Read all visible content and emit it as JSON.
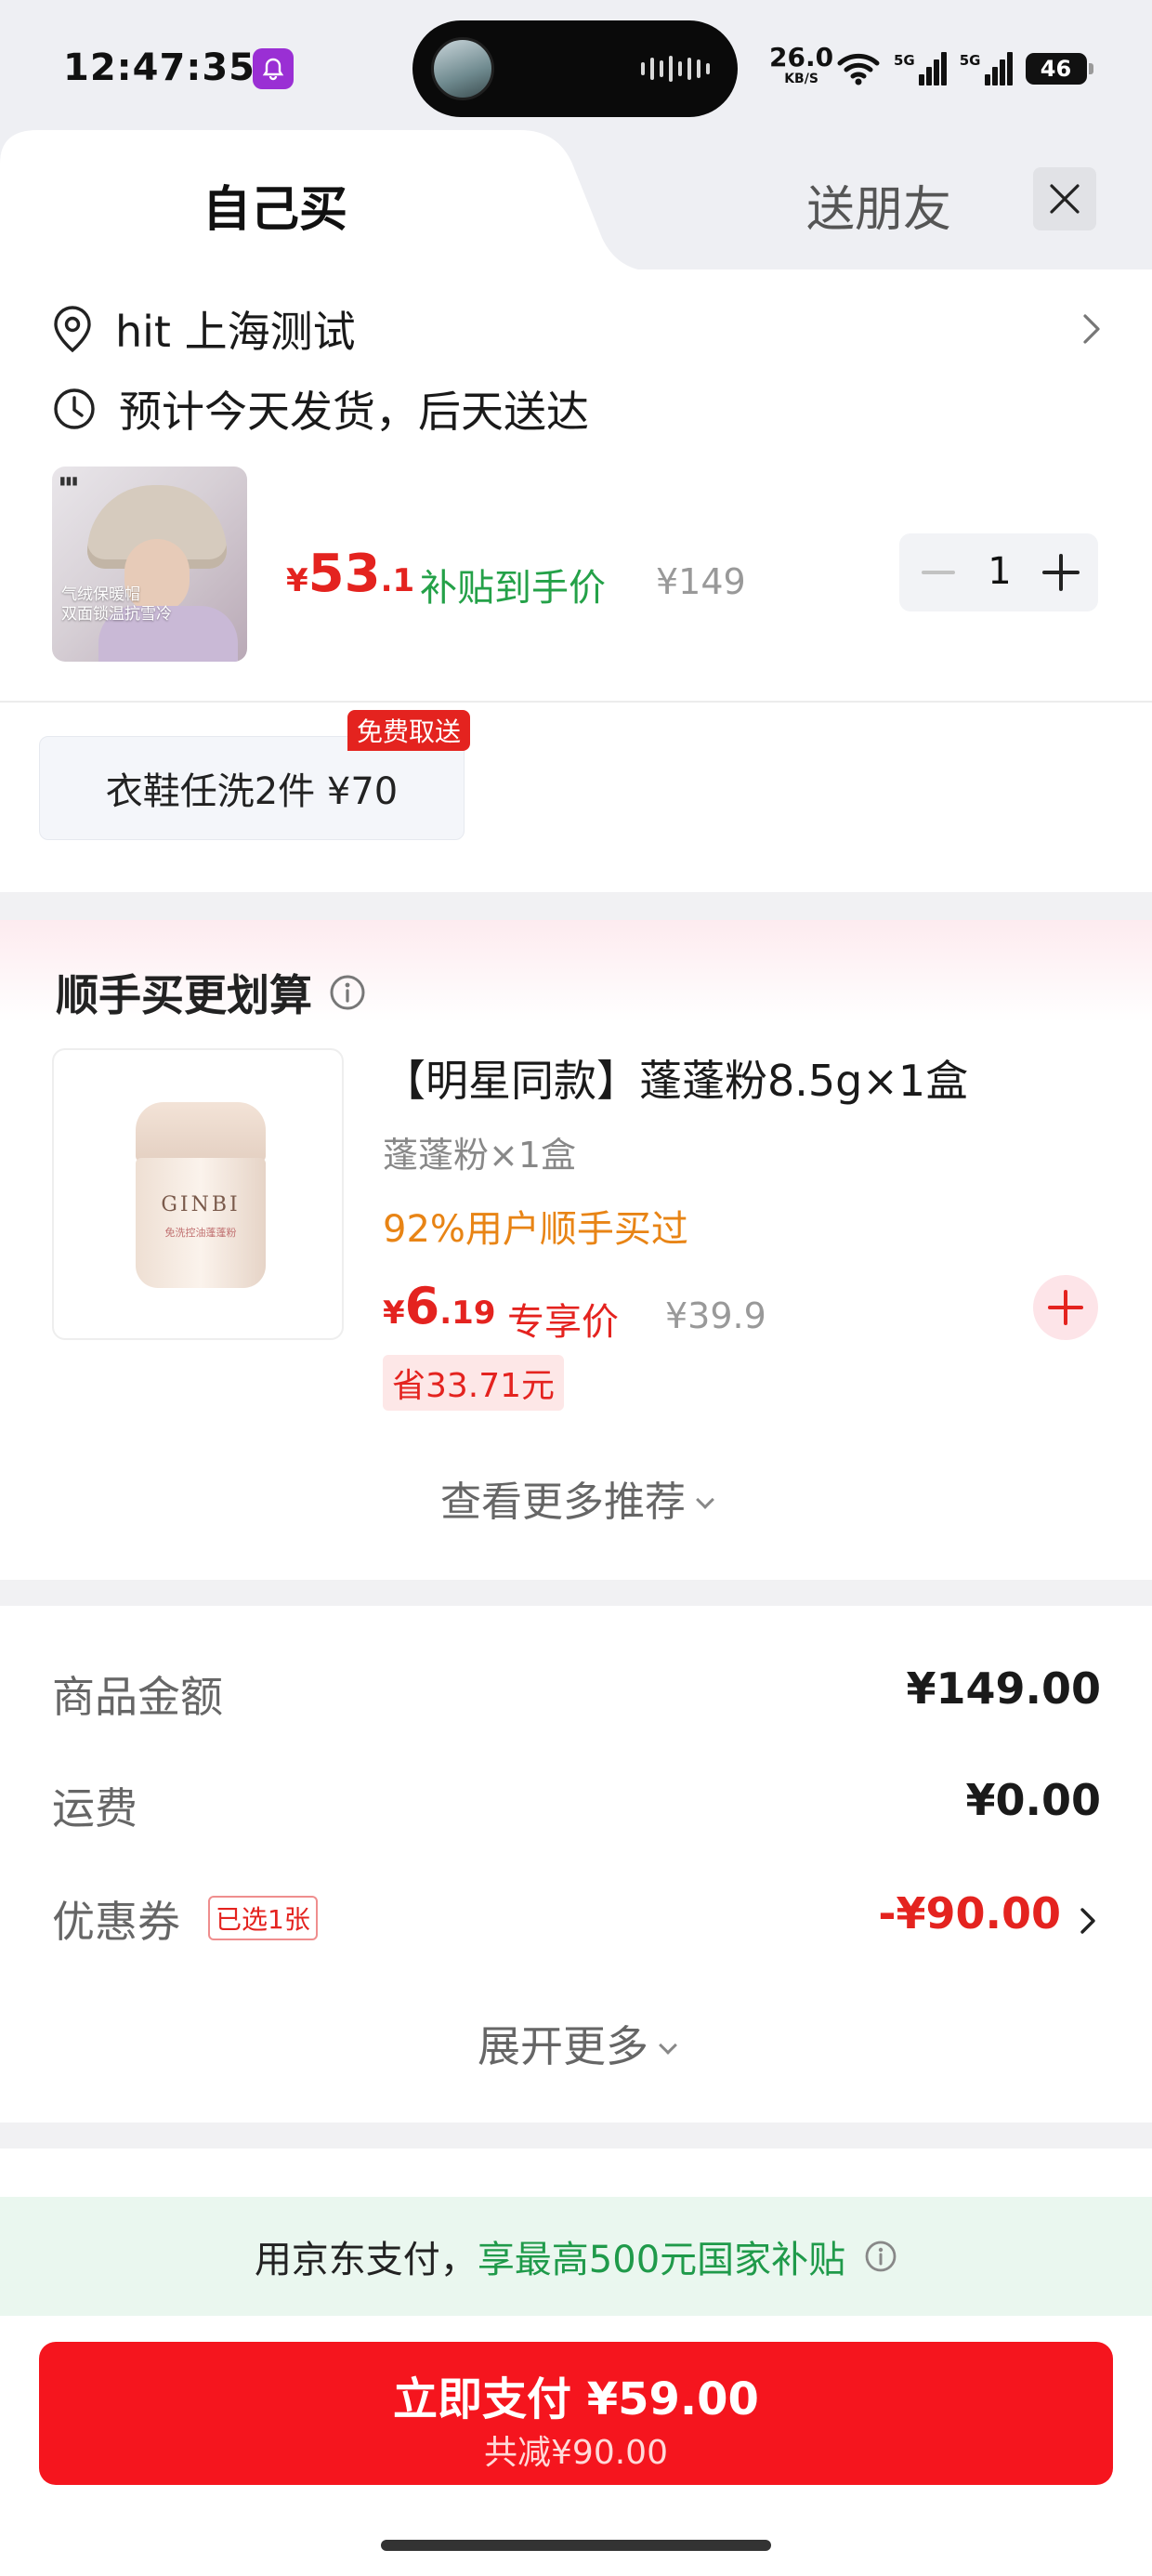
{
  "status_bar": {
    "time": "12:47:35",
    "net_speed": "26.0",
    "net_speed_unit": "KB/S",
    "sim1_label": "5G",
    "sim2_label": "5G",
    "battery": "46"
  },
  "tabs": {
    "self_buy": "自己买",
    "gift": "送朋友"
  },
  "address": {
    "text": "hit  上海测试"
  },
  "delivery": {
    "text": "预计今天发货，后天送达"
  },
  "product": {
    "thumb_overlay_line1": "气绒保暖帽",
    "thumb_overlay_line2": "双面锁温抗雪冷",
    "price_currency": "¥",
    "price_int": "53",
    "price_dec": ".1",
    "subsidy_label": "补贴到手价",
    "original_price": "¥149",
    "quantity": "1"
  },
  "service": {
    "badge": "免费取送",
    "label": "衣鞋任洗2件  ¥70"
  },
  "recommend": {
    "title": "顺手买更划算",
    "item": {
      "jar_brand": "GINBI",
      "jar_sub": "免洗控油蓬蓬粉",
      "name": "【明星同款】蓬蓬粉8.5g×1盒",
      "spec": "蓬蓬粉×1盒",
      "social_proof": "92%用户顺手买过",
      "price_currency": "¥",
      "price_int": "6",
      "price_dec": ".19",
      "price_label": "专享价",
      "original_price": "¥39.9",
      "save_label": "省33.71元"
    },
    "see_more": "查看更多推荐"
  },
  "summary": {
    "goods_label": "商品金额",
    "goods_value": "¥149.00",
    "shipping_label": "运费",
    "shipping_value": "¥0.00",
    "coupon_label": "优惠券",
    "coupon_tag": "已选1张",
    "coupon_value": "-¥90.00",
    "expand": "展开更多"
  },
  "jd_pay": {
    "text_a": "用京东支付，",
    "text_b": "享最高500元国家补贴"
  },
  "pay_button": {
    "main": "立即支付 ¥59.00",
    "sub": "共减¥90.00"
  },
  "colors": {
    "accent_red": "#e4231f",
    "button_red": "#f5151e",
    "subsidy_green": "#24a148",
    "social_orange": "#e88415"
  }
}
